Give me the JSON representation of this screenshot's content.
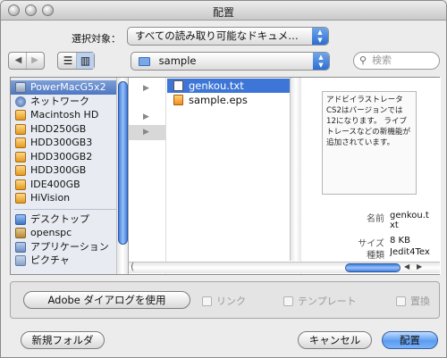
{
  "title": "配置",
  "select_target": {
    "label": "選択対象：",
    "value": "すべての読み取り可能なドキュメ…"
  },
  "location": {
    "folder": "sample"
  },
  "search": {
    "placeholder": "検索"
  },
  "sidebar": {
    "devices": [
      {
        "label": "PowerMacG5x2",
        "icon": "computer-icon",
        "selected": true
      },
      {
        "label": "ネットワーク",
        "icon": "network-icon"
      },
      {
        "label": "Macintosh HD",
        "icon": "hard-disk-icon"
      },
      {
        "label": "HDD250GB",
        "icon": "hard-disk-icon"
      },
      {
        "label": "HDD300GB3",
        "icon": "hard-disk-icon"
      },
      {
        "label": "HDD300GB2",
        "icon": "hard-disk-icon"
      },
      {
        "label": "HDD300GB",
        "icon": "hard-disk-icon"
      },
      {
        "label": "IDE400GB",
        "icon": "hard-disk-icon"
      },
      {
        "label": "HiVision",
        "icon": "hard-disk-icon"
      }
    ],
    "places": [
      {
        "label": "デスクトップ",
        "icon": "desktop-icon"
      },
      {
        "label": "openspc",
        "icon": "home-icon"
      },
      {
        "label": "アプリケーション",
        "icon": "applications-icon"
      },
      {
        "label": "ピクチャ",
        "icon": "pictures-icon"
      }
    ]
  },
  "files": [
    {
      "name": "genkou.txt",
      "icon": "text-file-icon",
      "selected": true
    },
    {
      "name": "sample.eps",
      "icon": "eps-file-icon"
    }
  ],
  "preview": {
    "text": "アドビイラストレータCS2はバージョンでは12になります。\nライブトレースなどの新機能が追加されています。",
    "name_label": "名前",
    "name_value": "genkou.t\nxt",
    "size_label": "サイズ",
    "size_value": "8 KB",
    "kind_label": "種類",
    "kind_value": "Jedit4Tex"
  },
  "options": {
    "adobe_dialog_button": "Adobe ダイアログを使用",
    "link": "リンク",
    "template": "テンプレート",
    "replace": "置換"
  },
  "buttons": {
    "new_folder": "新規フォルダ",
    "cancel": "キャンセル",
    "place": "配置"
  },
  "colors": {
    "selection": "#3d76d6",
    "accent": "#5b9cf0"
  }
}
